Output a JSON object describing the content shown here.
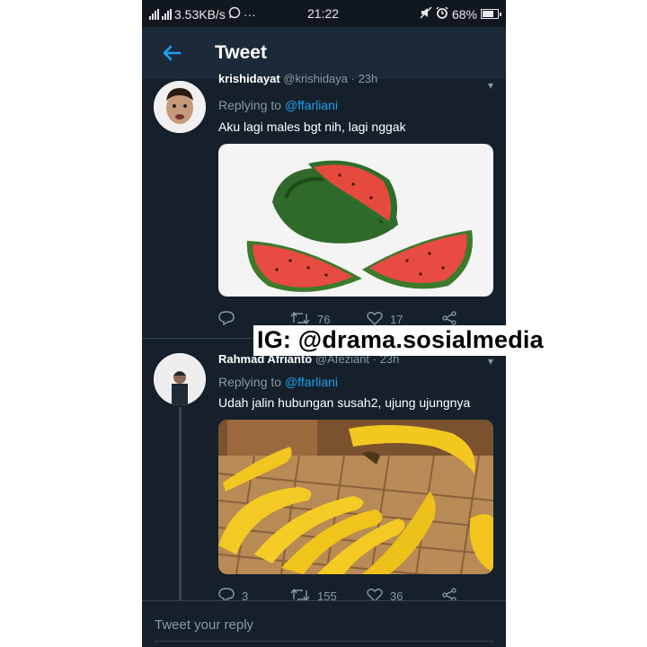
{
  "status_bar": {
    "network": "3.53KB/s",
    "clock": "21:22",
    "battery": "68%",
    "icons": [
      "signal-icon",
      "whatsapp-icon",
      "more-icon",
      "mute-icon",
      "alarm-icon",
      "battery-icon"
    ]
  },
  "header": {
    "title": "Tweet",
    "back_icon": "back-arrow-icon"
  },
  "tweets": [
    {
      "name": "krishidayat",
      "handle": "@krishidaya",
      "time": "23h",
      "replying_to_prefix": "Replying to",
      "replying_to": "@ffarliani",
      "text": "Aku lagi males bgt nih, lagi nggak",
      "media": "watermelon-photo",
      "replies": "",
      "retweets": "76",
      "likes": "17"
    },
    {
      "name": "Rahmad Afrianto",
      "handle": "@Afeziant",
      "time": "23h",
      "replying_to_prefix": "Replying to",
      "replying_to": "@ffarliani",
      "text": "Udah jalin hubungan susah2, ujung ujungnya",
      "media": "banana-photo",
      "replies": "3",
      "retweets": "155",
      "likes": "36"
    }
  ],
  "reply_bar": {
    "placeholder": "Tweet your reply"
  },
  "watermark": "IG: @drama.sosialmedia",
  "colors": {
    "background": "#15202b",
    "app_bar": "#1c2938",
    "accent": "#1da1f2",
    "muted": "#8899a6",
    "divider": "#38444d"
  }
}
